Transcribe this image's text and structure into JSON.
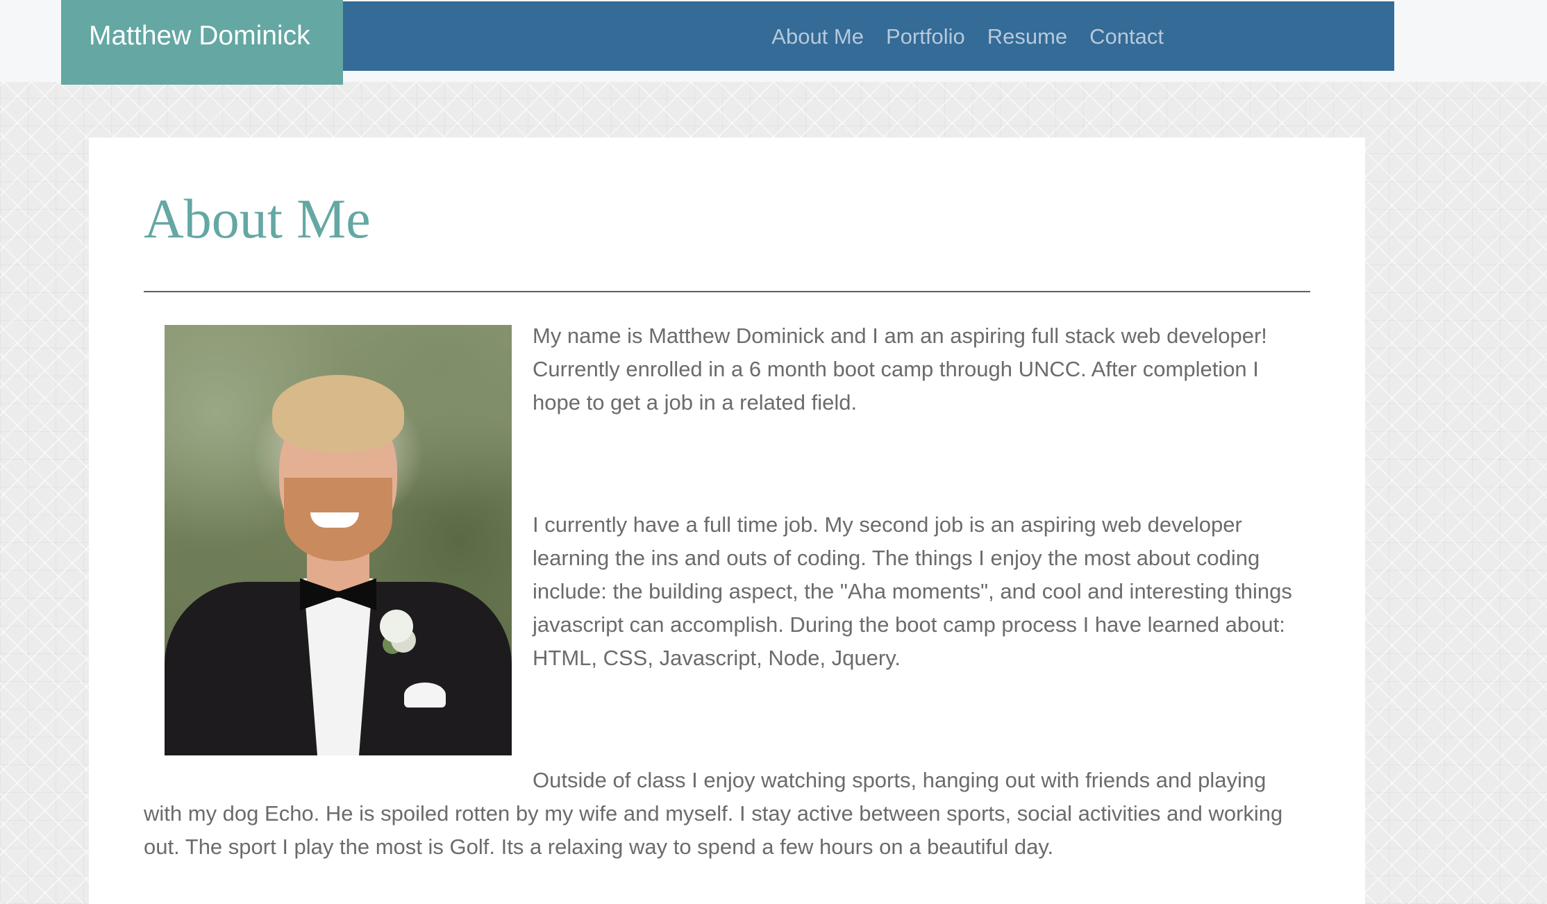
{
  "header": {
    "brand": "Matthew Dominick",
    "nav": [
      "About Me",
      "Portfolio",
      "Resume",
      "Contact"
    ]
  },
  "main": {
    "title": "About Me",
    "paragraphs": [
      "My name is Matthew Dominick and I am an aspiring full stack web developer! Currently enrolled in a 6 month boot camp through UNCC. After completion I hope to get a job in a related field.",
      "I currently have a full time job. My second job is an aspiring web developer learning the ins and outs of coding. The things I enjoy the most about coding include: the building aspect, the \"Aha moments\", and cool and interesting things javascript can accomplish. During the boot camp process I have learned about: HTML, CSS, Javascript, Node, Jquery.",
      "Outside of class I enjoy watching sports, hanging out with friends and playing with my dog Echo. He is spoiled rotten by my wife and myself. I stay active between sports, social activities and working out. The sport I play the most is Golf. Its a relaxing way to spend a few hours on a beautiful day."
    ]
  },
  "colors": {
    "navbar": "#346b97",
    "brand_background": "#64a7a3",
    "title": "#64a7a3",
    "body_text": "#6b6b6b"
  }
}
